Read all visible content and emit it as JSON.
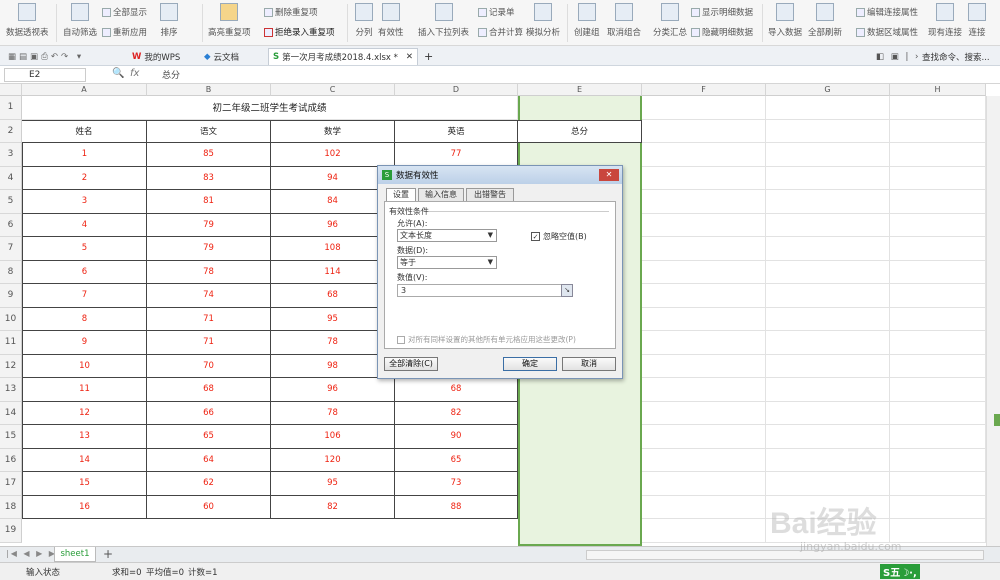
{
  "ribbon": {
    "pivot": "数据透视表",
    "autofilter": "自动筛选",
    "showall": "全部显示",
    "reapply": "重新应用",
    "sort": "排序",
    "highlight_dup": "高亮重复项",
    "remove_dup": "删除重复项",
    "reject_dup": "拒绝录入重复项",
    "split": "分列",
    "validity": "有效性",
    "dropdown": "插入下拉列表",
    "consolidate": "合并计算",
    "record": "记录单",
    "whatif": "模拟分析",
    "group": "创建组",
    "ungroup": "取消组合",
    "subtotal": "分类汇总",
    "showdetail": "显示明细数据",
    "hidedetail": "隐藏明细数据",
    "import": "导入数据",
    "refreshall": "全部刷新",
    "editlink": "编辑连接属性",
    "dataarea": "数据区域属性",
    "existing": "现有连接",
    "connect": "连接"
  },
  "tabs": {
    "mywps": "我的WPS",
    "cloud": "云文档",
    "file": "第一次月考成绩2018.4.xlsx *",
    "add": "+",
    "search": "查找命令、搜索..."
  },
  "formula": {
    "cellref": "E2",
    "fx": "fx",
    "value": "总分"
  },
  "columns": [
    "A",
    "B",
    "C",
    "D",
    "E",
    "F",
    "G",
    "H"
  ],
  "rows": [
    "1",
    "2",
    "3",
    "4",
    "5",
    "6",
    "7",
    "8",
    "9",
    "10",
    "11",
    "12",
    "13",
    "14",
    "15",
    "16",
    "17",
    "18",
    "19"
  ],
  "sheet": {
    "title": "初二年级二班学生考试成绩",
    "headers": [
      "姓名",
      "语文",
      "数学",
      "英语",
      "总分"
    ],
    "data": [
      [
        "1",
        "85",
        "102",
        "77"
      ],
      [
        "2",
        "83",
        "94",
        ""
      ],
      [
        "3",
        "81",
        "84",
        ""
      ],
      [
        "4",
        "79",
        "96",
        ""
      ],
      [
        "5",
        "79",
        "108",
        ""
      ],
      [
        "6",
        "78",
        "114",
        ""
      ],
      [
        "7",
        "74",
        "68",
        ""
      ],
      [
        "8",
        "71",
        "95",
        ""
      ],
      [
        "9",
        "71",
        "78",
        ""
      ],
      [
        "10",
        "70",
        "98",
        ""
      ],
      [
        "11",
        "68",
        "96",
        "68"
      ],
      [
        "12",
        "66",
        "78",
        "82"
      ],
      [
        "13",
        "65",
        "106",
        "90"
      ],
      [
        "14",
        "64",
        "120",
        "65"
      ],
      [
        "15",
        "62",
        "95",
        "73"
      ],
      [
        "16",
        "60",
        "82",
        "88"
      ]
    ]
  },
  "dialog": {
    "title": "数据有效性",
    "tab_settings": "设置",
    "tab_input": "输入信息",
    "tab_error": "出错警告",
    "criteria": "有效性条件",
    "allow_label": "允许(A):",
    "allow_value": "文本长度",
    "ignore_blank": "忽略空值(B)",
    "data_label": "数据(D):",
    "data_value": "等于",
    "value_label": "数值(V):",
    "value_value": "3",
    "apply_all": "对所有同样设置的其他所有单元格应用这些更改(P)",
    "clear_all": "全部清除(C)",
    "ok": "确定",
    "cancel": "取消"
  },
  "sheetbar": {
    "sheet1": "sheet1",
    "add": "+"
  },
  "status": {
    "mode": "输入状态",
    "sum": "求和=0",
    "avg": "平均值=0",
    "count": "计数=1"
  },
  "watermark": {
    "baidu": "Bai经验",
    "url": "jingyan.baidu.com"
  }
}
